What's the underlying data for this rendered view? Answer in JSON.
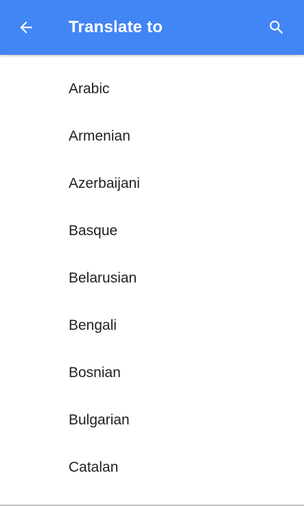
{
  "app_bar": {
    "title": "Translate to",
    "back_icon": "arrow-back-icon",
    "search_icon": "search-icon",
    "background_color": "#4285f4",
    "foreground_color": "#ffffff"
  },
  "language_list": {
    "items": [
      {
        "label": "Arabic"
      },
      {
        "label": "Armenian"
      },
      {
        "label": "Azerbaijani"
      },
      {
        "label": "Basque"
      },
      {
        "label": "Belarusian"
      },
      {
        "label": "Bengali"
      },
      {
        "label": "Bosnian"
      },
      {
        "label": "Bulgarian"
      },
      {
        "label": "Catalan"
      }
    ],
    "text_color": "#212121"
  }
}
